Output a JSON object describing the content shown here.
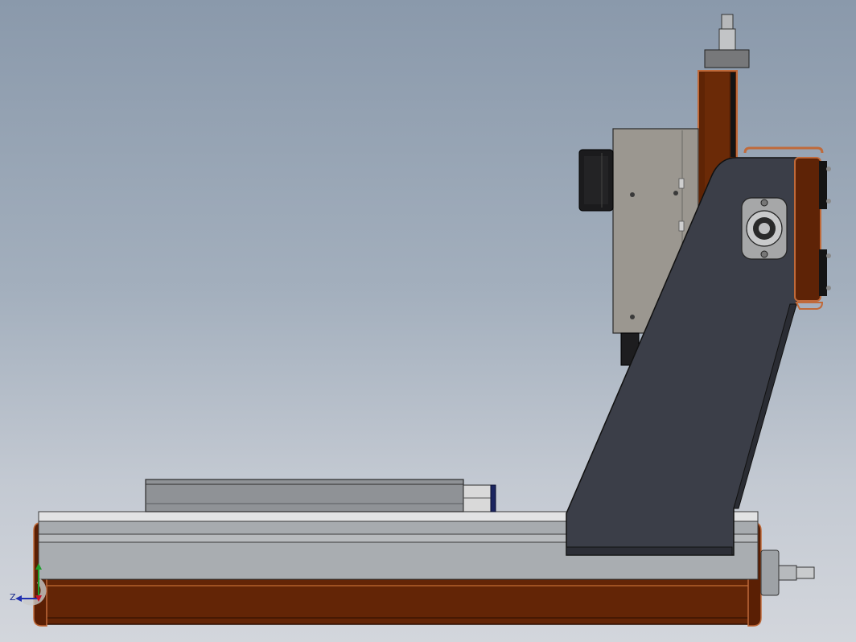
{
  "viewport": {
    "background_top": "#8a99ab",
    "background_bottom": "#d3d6dc"
  },
  "model": {
    "colors": {
      "frame_brown": "#6a2a08",
      "frame_brown_edge": "#c06a3a",
      "rail_gray": "#a9adb1",
      "rail_light": "#d6d8da",
      "column_dark": "#3a3d47",
      "spindle_gray": "#9b9790",
      "motor_black": "#1b1b1d"
    },
    "components": [
      "base-frame",
      "x-rail",
      "work-table",
      "gantry-column",
      "z-axis-carriage",
      "spindle-housing",
      "stepper-motor",
      "bearing-block",
      "lead-screw-end"
    ]
  },
  "triad": {
    "x_color": "#c8102e",
    "y_color": "#1e9e2a",
    "z_color": "#1f2fb0",
    "z_label": "Z",
    "icon": "coordinate-triad-icon"
  }
}
